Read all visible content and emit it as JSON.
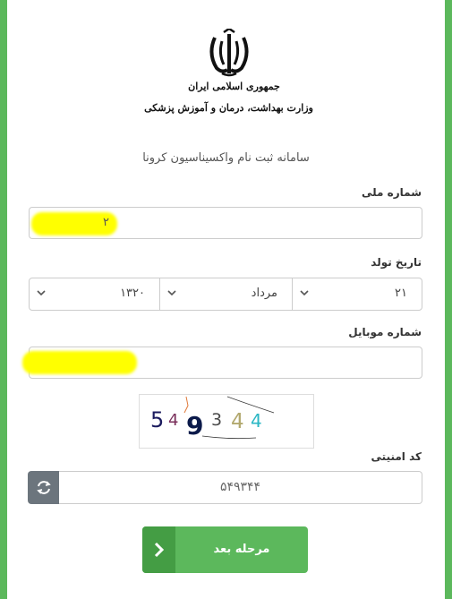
{
  "header": {
    "logo_line1": "جمهوری اسلامی ایران",
    "logo_line2": "وزارت بهداشت، درمان و آموزش پزشکی",
    "system_title": "سامانه ثبت نام واکسیناسیون کرونا"
  },
  "form": {
    "national_id": {
      "label": "شماره ملی",
      "value": "۲"
    },
    "birth_date": {
      "label": "تاریخ تولد",
      "day": "۲۱",
      "month": "مرداد",
      "year": "۱۳۲۰"
    },
    "mobile": {
      "label": "شماره موبایل",
      "value": ""
    },
    "captcha": {
      "image_text": "549344",
      "label": "کد امنیتی",
      "value": "۵۴۹۳۴۴"
    },
    "next_button": {
      "label": "مرحله بعد"
    }
  },
  "colors": {
    "brand_green": "#5cb85c",
    "brand_green_dark": "#449d44",
    "refresh_gray": "#6c757d",
    "redaction_yellow": "#ffff00"
  },
  "icons": {
    "emblem": "iran-emblem-icon",
    "dropdown": "chevron-down-icon",
    "refresh": "refresh-icon",
    "next": "chevron-right-icon"
  }
}
